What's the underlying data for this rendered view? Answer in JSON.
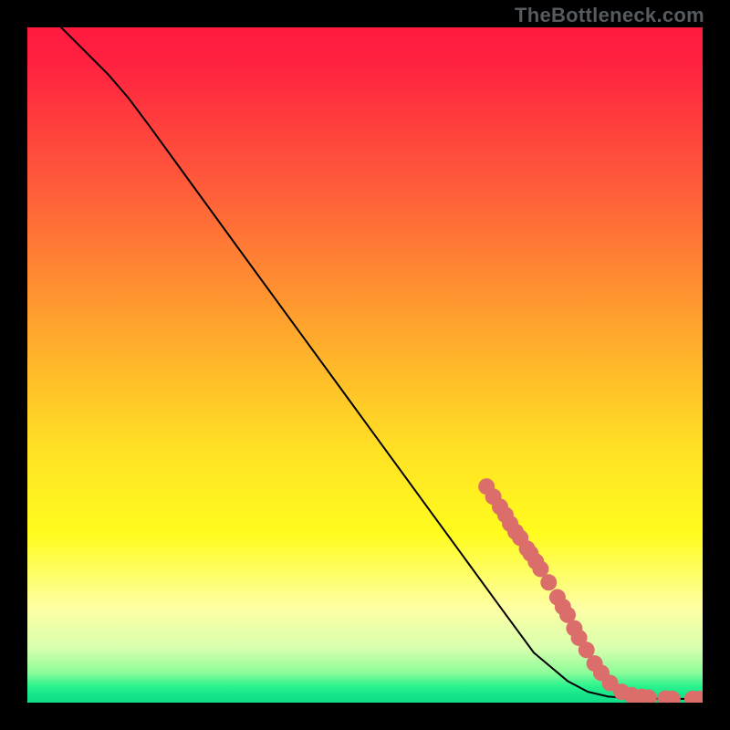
{
  "watermark": "TheBottleneck.com",
  "chart_data": {
    "type": "line",
    "xlim": [
      0,
      100
    ],
    "ylim": [
      0,
      100
    ],
    "xlabel": "",
    "ylabel": "",
    "title": "",
    "grid": false,
    "gradient_stops": [
      {
        "offset": 0.0,
        "color": "#ff1a3f"
      },
      {
        "offset": 0.05,
        "color": "#ff2140"
      },
      {
        "offset": 0.24,
        "color": "#ff5d3a"
      },
      {
        "offset": 0.5,
        "color": "#ffb82a"
      },
      {
        "offset": 0.63,
        "color": "#ffe224"
      },
      {
        "offset": 0.75,
        "color": "#fffc1e"
      },
      {
        "offset": 0.86,
        "color": "#feffa4"
      },
      {
        "offset": 0.92,
        "color": "#d7ffad"
      },
      {
        "offset": 0.955,
        "color": "#8efc9a"
      },
      {
        "offset": 0.975,
        "color": "#2df38e"
      },
      {
        "offset": 0.99,
        "color": "#13e38a"
      },
      {
        "offset": 1.0,
        "color": "#12de88"
      }
    ],
    "curve": [
      {
        "x": 5.0,
        "y": 100.0
      },
      {
        "x": 6.5,
        "y": 98.5
      },
      {
        "x": 8.0,
        "y": 97.0
      },
      {
        "x": 10.0,
        "y": 95.0
      },
      {
        "x": 12.0,
        "y": 93.0
      },
      {
        "x": 15.0,
        "y": 89.5
      },
      {
        "x": 18.0,
        "y": 85.5
      },
      {
        "x": 22.0,
        "y": 80.0
      },
      {
        "x": 30.0,
        "y": 69.0
      },
      {
        "x": 40.0,
        "y": 55.3
      },
      {
        "x": 50.0,
        "y": 41.6
      },
      {
        "x": 60.0,
        "y": 27.9
      },
      {
        "x": 70.0,
        "y": 14.2
      },
      {
        "x": 75.0,
        "y": 7.4
      },
      {
        "x": 80.0,
        "y": 3.2
      },
      {
        "x": 83.0,
        "y": 1.6
      },
      {
        "x": 86.0,
        "y": 0.9
      },
      {
        "x": 90.0,
        "y": 0.6
      },
      {
        "x": 95.0,
        "y": 0.55
      },
      {
        "x": 100.0,
        "y": 0.55
      }
    ],
    "dots": [
      {
        "x": 68.0,
        "y": 32.0
      },
      {
        "x": 69.0,
        "y": 30.5
      },
      {
        "x": 70.0,
        "y": 29.0
      },
      {
        "x": 70.8,
        "y": 27.8
      },
      {
        "x": 71.5,
        "y": 26.5
      },
      {
        "x": 72.3,
        "y": 25.3
      },
      {
        "x": 73.0,
        "y": 24.4
      },
      {
        "x": 74.0,
        "y": 22.8
      },
      {
        "x": 74.5,
        "y": 22.1
      },
      {
        "x": 75.3,
        "y": 20.9
      },
      {
        "x": 76.0,
        "y": 19.8
      },
      {
        "x": 77.2,
        "y": 17.8
      },
      {
        "x": 78.5,
        "y": 15.6
      },
      {
        "x": 79.3,
        "y": 14.2
      },
      {
        "x": 80.0,
        "y": 13.0
      },
      {
        "x": 81.0,
        "y": 11.0
      },
      {
        "x": 81.7,
        "y": 9.6
      },
      {
        "x": 82.8,
        "y": 7.8
      },
      {
        "x": 84.0,
        "y": 5.8
      },
      {
        "x": 85.0,
        "y": 4.4
      },
      {
        "x": 86.3,
        "y": 2.9
      },
      {
        "x": 88.0,
        "y": 1.6
      },
      {
        "x": 89.5,
        "y": 1.1
      },
      {
        "x": 91.0,
        "y": 0.85
      },
      {
        "x": 92.0,
        "y": 0.75
      },
      {
        "x": 94.5,
        "y": 0.6
      },
      {
        "x": 95.5,
        "y": 0.55
      },
      {
        "x": 98.5,
        "y": 0.55
      },
      {
        "x": 99.5,
        "y": 0.55
      }
    ],
    "dot_color": "#db6e6a",
    "dot_radius": 9,
    "curve_color": "#000000",
    "curve_width": 2
  }
}
